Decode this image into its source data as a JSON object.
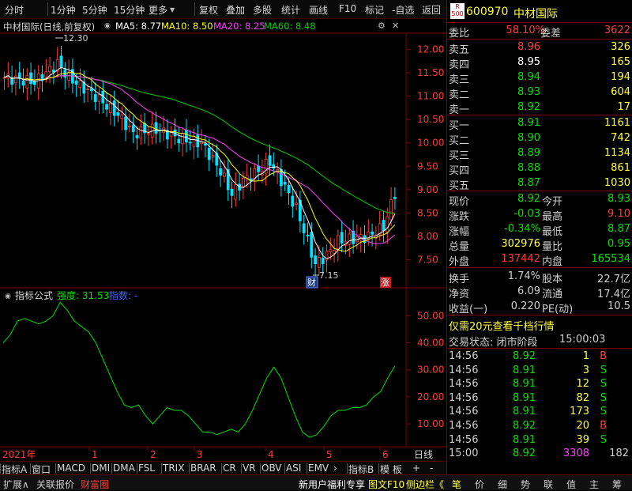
{
  "toolbar": {
    "items": [
      "分时",
      "1分钟",
      "5分钟",
      "15分钟",
      "更多",
      "复权",
      "叠加",
      "多股",
      "统计",
      "画线",
      "F10",
      "标记",
      "-自选",
      "返回"
    ]
  },
  "chart_info": {
    "title": "中材国际(日线,前复权)",
    "ma5": "MA5: 8.77",
    "ma10": "MA10: 8.50",
    "ma20": "MA20: 8.25",
    "ma60": "MA60: 8.48",
    "high_label": "12.30",
    "low_label": "7.15",
    "cai_badge": "财",
    "zhang_badge": "涨"
  },
  "indicator": {
    "name": "指标公式",
    "strength": "强度: 31.53",
    "index": "指数: -"
  },
  "x_axis": {
    "year": "2021年",
    "months": [
      "1",
      "2",
      "3",
      "4",
      "5",
      "6"
    ],
    "period": "日线"
  },
  "price_axis": [
    "12.00",
    "11.50",
    "11.00",
    "10.50",
    "10.00",
    "9.50",
    "9.00",
    "8.50",
    "8.00",
    "7.50"
  ],
  "ind_axis": [
    "50.00",
    "40.00",
    "30.00",
    "20.00",
    "10.00"
  ],
  "chart_data": [
    {
      "type": "candlestick",
      "title": "中材国际(日线,前复权)",
      "ylim": [
        7.0,
        12.5
      ],
      "series": [
        {
          "name": "MA5",
          "color": "#ffffff"
        },
        {
          "name": "MA10",
          "color": "#ffff00"
        },
        {
          "name": "MA20",
          "color": "#ff40ff"
        },
        {
          "name": "MA60",
          "color": "#00d000"
        }
      ],
      "annotations": {
        "max": 12.3,
        "min": 7.15
      }
    },
    {
      "type": "line",
      "title": "指标公式",
      "ylim": [
        3,
        58
      ],
      "values": [
        40,
        43,
        48,
        49,
        48,
        47,
        48,
        50,
        55,
        52,
        48,
        46,
        44,
        40,
        34,
        28,
        22,
        17,
        16,
        17,
        13,
        10,
        13,
        16,
        15,
        15,
        13,
        10,
        7,
        7,
        6,
        7,
        8,
        7,
        10,
        15,
        21,
        27,
        31,
        27,
        20,
        13,
        7,
        5,
        6,
        9,
        13,
        15,
        15,
        16,
        16,
        17,
        20,
        22,
        27,
        31.53
      ]
    }
  ],
  "quote": {
    "badge_r": "R",
    "badge_num": "500",
    "code": "600970",
    "name": "中材国际",
    "weibi_label": "委比",
    "weibi": "58.10%",
    "weicha_label": "委差",
    "weicha": "3622",
    "asks": [
      {
        "label": "卖五",
        "price": "8.96",
        "vol": "326",
        "pcolor": "#ff3c3c"
      },
      {
        "label": "卖四",
        "price": "8.95",
        "vol": "165",
        "pcolor": "#ffffff"
      },
      {
        "label": "卖三",
        "price": "8.94",
        "vol": "194",
        "pcolor": "#00e000"
      },
      {
        "label": "卖二",
        "price": "8.93",
        "vol": "604",
        "pcolor": "#00e000"
      },
      {
        "label": "卖一",
        "price": "8.92",
        "vol": "17",
        "pcolor": "#00e000"
      }
    ],
    "bids": [
      {
        "label": "买一",
        "price": "8.91",
        "vol": "1161",
        "pcolor": "#00e000"
      },
      {
        "label": "买二",
        "price": "8.90",
        "vol": "742",
        "pcolor": "#00e000"
      },
      {
        "label": "买三",
        "price": "8.89",
        "vol": "1134",
        "pcolor": "#00e000"
      },
      {
        "label": "买四",
        "price": "8.88",
        "vol": "861",
        "pcolor": "#00e000"
      },
      {
        "label": "买五",
        "price": "8.87",
        "vol": "1030",
        "pcolor": "#00e000"
      }
    ],
    "stats": [
      {
        "l1": "现价",
        "v1": "8.92",
        "c1": "#00e000",
        "l2": "今开",
        "v2": "8.93",
        "c2": "#00e000"
      },
      {
        "l1": "涨跌",
        "v1": "-0.03",
        "c1": "#00e000",
        "l2": "最高",
        "v2": "9.10",
        "c2": "#ff3c3c"
      },
      {
        "l1": "涨幅",
        "v1": "-0.34%",
        "c1": "#00e000",
        "l2": "最低",
        "v2": "8.87",
        "c2": "#00e000"
      },
      {
        "l1": "总量",
        "v1": "302976",
        "c1": "#ffff40",
        "l2": "量比",
        "v2": "0.95",
        "c2": "#00e000"
      },
      {
        "l1": "外盘",
        "v1": "137442",
        "c1": "#ff3c3c",
        "l2": "内盘",
        "v2": "165534",
        "c2": "#00e000"
      }
    ],
    "fin": [
      {
        "l1": "换手",
        "v1": "1.74%",
        "l2": "股本",
        "v2": "22.7亿"
      },
      {
        "l1": "净资",
        "v1": "6.09",
        "l2": "流通",
        "v2": "17.4亿"
      },
      {
        "l1": "收益(一)",
        "v1": "0.220",
        "l2": "PE(动)",
        "v2": "10.5"
      }
    ],
    "promo": "仅需20元查看千档行情",
    "trade_state_label": "交易状态: 闭市阶段",
    "trade_state_time": "15:00:03",
    "ticks": [
      {
        "time": "14:56",
        "price": "8.92",
        "vol": "1",
        "bs": "B"
      },
      {
        "time": "14:56",
        "price": "8.91",
        "vol": "3",
        "bs": "S"
      },
      {
        "time": "14:56",
        "price": "8.91",
        "vol": "12",
        "bs": "S"
      },
      {
        "time": "14:56",
        "price": "8.91",
        "vol": "82",
        "bs": "S"
      },
      {
        "time": "14:56",
        "price": "8.91",
        "vol": "173",
        "bs": "S"
      },
      {
        "time": "14:56",
        "price": "8.92",
        "vol": "20",
        "bs": "B"
      },
      {
        "time": "14:56",
        "price": "8.91",
        "vol": "39",
        "bs": "S"
      },
      {
        "time": "15:00",
        "price": "8.92",
        "vol": "3308",
        "bs": "182"
      }
    ]
  },
  "tabs": [
    "指标A",
    "窗口",
    "MACD",
    "DMI",
    "DMA",
    "FSL",
    "TRIX",
    "BRAR",
    "CR",
    "VR",
    "OBV",
    "ASI",
    "EMV",
    "指标B",
    "模 板"
  ],
  "status": {
    "left": [
      "扩展∧",
      "关联报价",
      "财富圈"
    ],
    "mid": [
      "新用户福利专享",
      "图文F10",
      "侧边栏《"
    ],
    "right": [
      "笔",
      "价",
      "细",
      "势",
      "联",
      "值",
      "主",
      "筹"
    ]
  },
  "colors": {
    "up": "#ff3c3c",
    "down": "#00e0ff",
    "accent": "#ffff40",
    "border": "#800000"
  }
}
